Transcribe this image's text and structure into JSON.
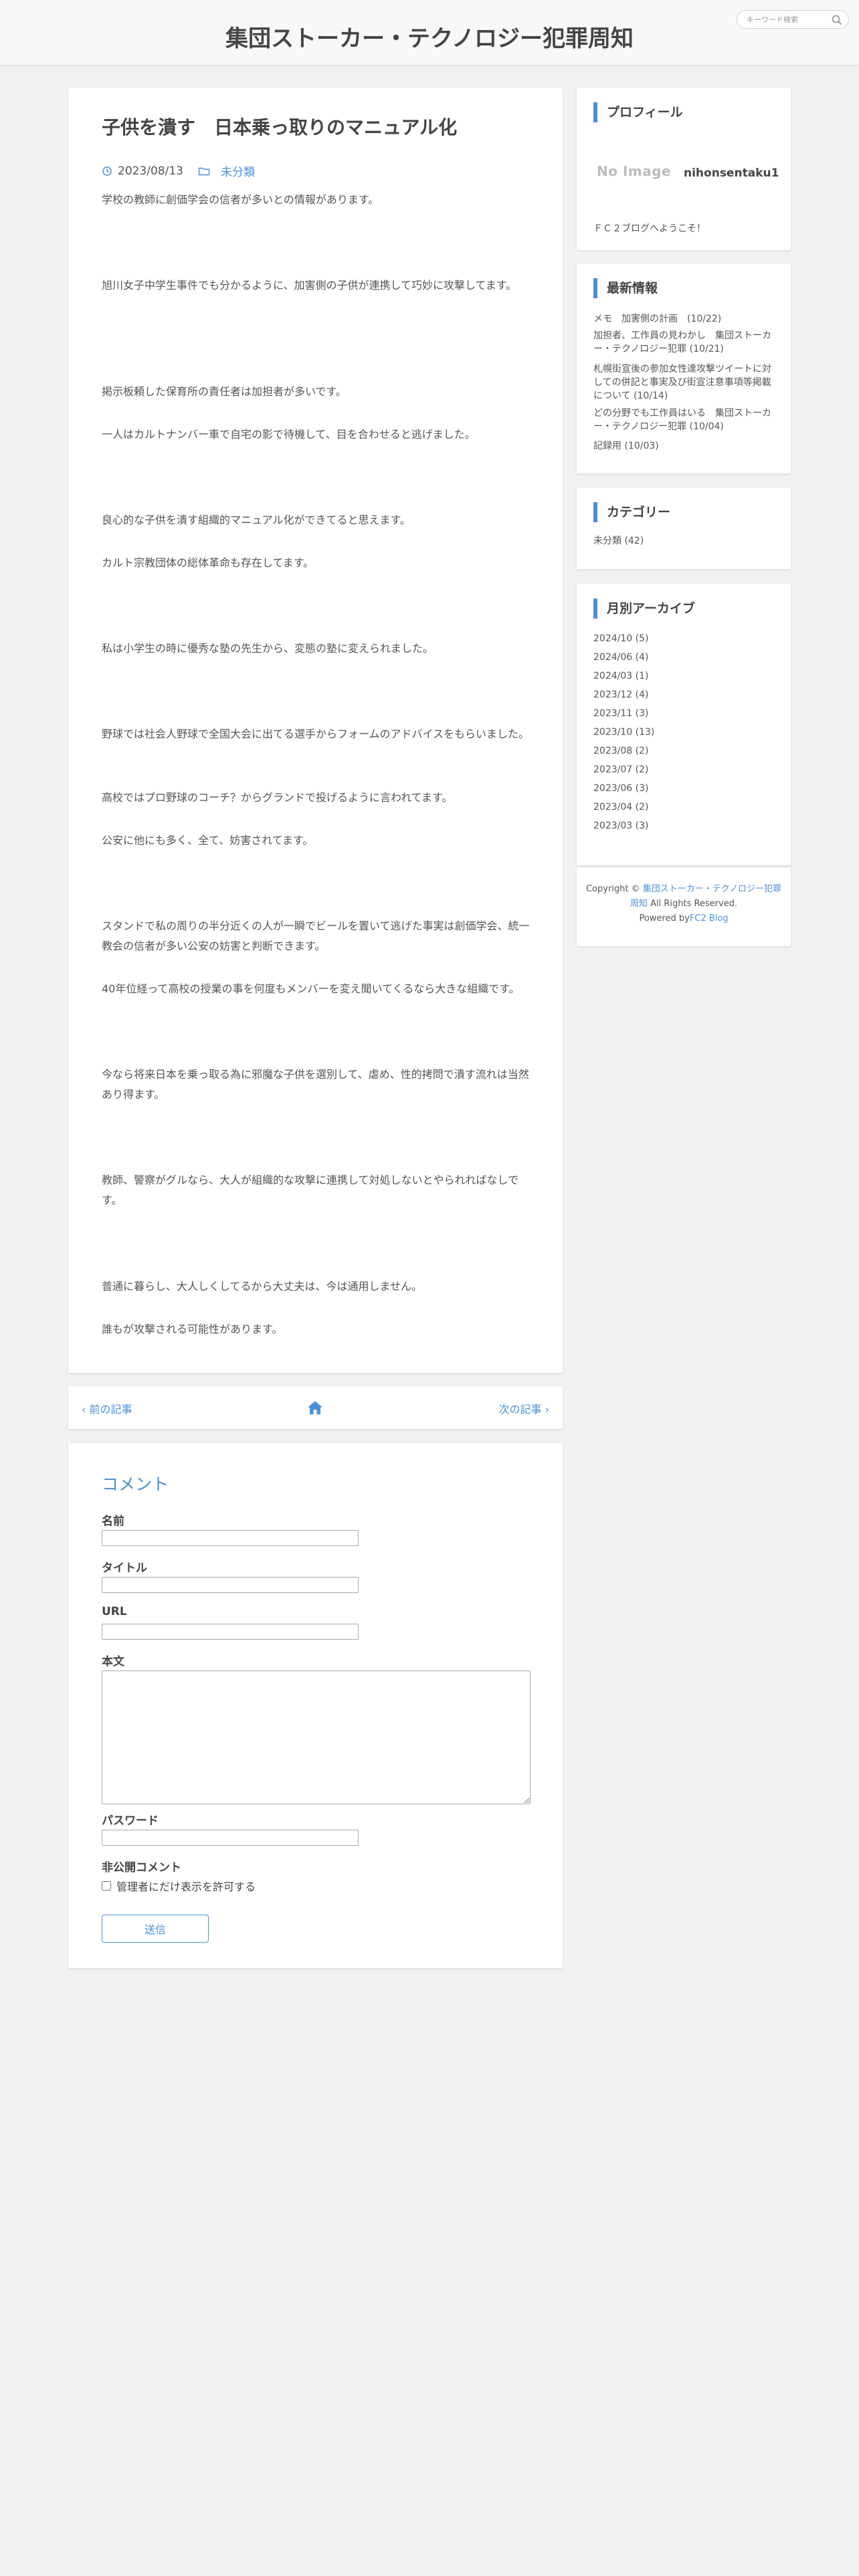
{
  "header": {
    "site_title": "集団ストーカー・テクノロジー犯罪周知",
    "search_placeholder": "キーワード検索"
  },
  "article": {
    "title": "子供を潰す　日本乗っ取りのマニュアル化",
    "date": "2023/08/13",
    "category": "未分類",
    "paragraphs": [
      "学校の教師に創価学会の信者が多いとの情報があります。",
      "旭川女子中学生事件でも分かるように、加害側の子供が連携して巧妙に攻撃してます。",
      "掲示板頼した保育所の責任者は加担者が多いです。",
      "一人はカルトナンバー車で自宅の影で待機して、目を合わせると逃げました。",
      "良心的な子供を潰す組織的マニュアル化ができてると思えます。",
      "カルト宗教団体の総体革命も存在してます。",
      "私は小学生の時に優秀な塾の先生から、変態の塾に変えられました。",
      "野球では社会人野球で全国大会に出てる選手からフォームのアドバイスをもらいました。",
      "高校ではプロ野球のコーチ？からグランドで投げるように言われてます。",
      "公安に他にも多く、全て、妨害されてます。",
      "スタンドで私の周りの半分近くの人が一瞬でビールを置いて逃げた事実は創価学会、統一教会の信者が多い公安の妨害と判断できます。",
      "40年位経って高校の授業の事を何度もメンバーを変え聞いてくるなら大きな組織です。",
      "今なら将来日本を乗っ取る為に邪魔な子供を選別して、虐め、性的拷問で潰す流れは当然あり得ます。",
      "教師、警察がグルなら、大人が組織的な攻撃に連携して対処しないとやられればなしです。",
      "普通に暮らし、大人しくしてるから大丈夫は、今は通用しません。",
      "誰もが攻撃される可能性があります。"
    ]
  },
  "pager": {
    "prev": "前の記事",
    "next": "次の記事"
  },
  "comment_form": {
    "title": "コメント",
    "name_label": "名前",
    "title_label": "タイトル",
    "url_label": "URL",
    "body_label": "本文",
    "password_label": "パスワード",
    "private_label": "非公開コメント",
    "private_checkbox": "管理者にだけ表示を許可する",
    "submit": "送信"
  },
  "sidebar": {
    "profile": {
      "heading": "プロフィール",
      "no_image": "No Image",
      "name": "nihonsentaku1",
      "message": "ＦＣ２ブログへようこそ！"
    },
    "recent": {
      "heading": "最新情報",
      "items": [
        "メモ　加害側の計画　(10/22)",
        "加担者、工作員の見わかし　集団ストーカー・テクノロジー犯罪 (10/21)",
        "札幌街宣後の参加女性達攻撃ツイートに対しての併記と事実及び街宣注意事項等掲載について (10/14)",
        "どの分野でも工作員はいる　集団ストーカー・テクノロジー犯罪 (10/04)",
        "記録用 (10/03)"
      ]
    },
    "categories": {
      "heading": "カテゴリー",
      "items": [
        "未分類 (42)"
      ]
    },
    "archive": {
      "heading": "月別アーカイブ",
      "items": [
        "2024/10 (5)",
        "2024/06 (4)",
        "2024/03 (1)",
        "2023/12 (4)",
        "2023/11 (3)",
        "2023/10 (13)",
        "2023/08 (2)",
        "2023/07 (2)",
        "2023/06 (3)",
        "2023/04 (2)",
        "2023/03 (3)"
      ]
    },
    "footer": {
      "copyright": "Copyright ©",
      "site_link": "集団ストーカー・テクノロジー犯罪周知",
      "rights": "All Rights Reserved.",
      "powered_by": "Powered by",
      "powered_link": "FC2 Blog"
    }
  },
  "colors": {
    "accent": "#4a90d9",
    "background": "#f1f1f1",
    "card": "#ffffff",
    "text": "#444444"
  }
}
